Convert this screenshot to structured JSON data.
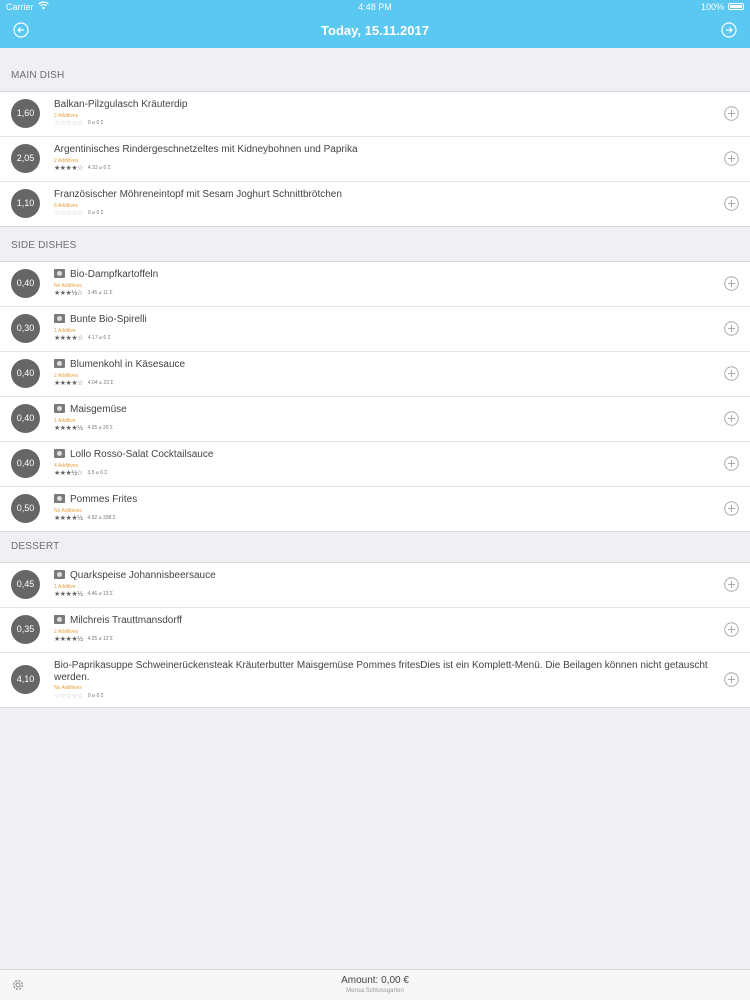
{
  "status_bar": {
    "carrier": "Carrier",
    "time": "4:48 PM",
    "battery": "100%"
  },
  "nav": {
    "title": "Today, 15.11.2017"
  },
  "sections": [
    {
      "header": "MAIN DISH",
      "items": [
        {
          "price": "1,60",
          "name": "Balkan-Pilzgulasch Kräuterdip",
          "has_photo": false,
          "additives": "2 Additives",
          "stars": "☆☆☆☆☆",
          "stars_filled": false,
          "rating_text": "0 ⌀ 0 Σ"
        },
        {
          "price": "2,05",
          "name": "Argentinisches Rindergeschnetzeltes mit Kidneybohnen und Paprika",
          "has_photo": false,
          "additives": "2 Additives",
          "stars": "★★★★☆",
          "stars_filled": true,
          "rating_text": "4.33 ⌀ 6 Σ"
        },
        {
          "price": "1,10",
          "name": "Französischer Möhreneintopf mit Sesam Joghurt Schnittbrötchen",
          "has_photo": false,
          "additives": "8 Additives",
          "stars": "☆☆☆☆☆",
          "stars_filled": false,
          "rating_text": "0 ⌀ 0 Σ"
        }
      ]
    },
    {
      "header": "SIDE DISHES",
      "items": [
        {
          "price": "0,40",
          "name": "Bio-Dampfkartoffeln",
          "has_photo": true,
          "additives": "No Additives",
          "stars": "★★★½☆",
          "stars_filled": true,
          "rating_text": "3.45 ⌀ 11 Σ"
        },
        {
          "price": "0,30",
          "name": "Bunte Bio-Spirelli",
          "has_photo": true,
          "additives": "1 Additive",
          "stars": "★★★★☆",
          "stars_filled": true,
          "rating_text": "4.17 ⌀ 6 Σ"
        },
        {
          "price": "0,40",
          "name": "Blumenkohl in Käsesauce",
          "has_photo": true,
          "additives": "2 Additives",
          "stars": "★★★★☆",
          "stars_filled": true,
          "rating_text": "4.04 ⌀ 23 Σ"
        },
        {
          "price": "0,40",
          "name": "Maisgemüse",
          "has_photo": true,
          "additives": "1 Additive",
          "stars": "★★★★½",
          "stars_filled": true,
          "rating_text": "4.25 ⌀ 20 Σ"
        },
        {
          "price": "0,40",
          "name": "Lollo Rosso-Salat Cocktailsauce",
          "has_photo": true,
          "additives": "4 Additives",
          "stars": "★★★½☆",
          "stars_filled": true,
          "rating_text": "3.5 ⌀ 6 Σ"
        },
        {
          "price": "0,50",
          "name": "Pommes Frites",
          "has_photo": true,
          "additives": "No Additives",
          "stars": "★★★★½",
          "stars_filled": true,
          "rating_text": "4.52 ⌀ 338 Σ"
        }
      ]
    },
    {
      "header": "DESSERT",
      "items": [
        {
          "price": "0,45",
          "name": "Quarkspeise Johannisbeersauce",
          "has_photo": true,
          "additives": "1 Additive",
          "stars": "★★★★½",
          "stars_filled": true,
          "rating_text": "4.46 ⌀ 13 Σ"
        },
        {
          "price": "0,35",
          "name": "Milchreis Trauttmansdorff",
          "has_photo": true,
          "additives": "2 Additives",
          "stars": "★★★★½",
          "stars_filled": true,
          "rating_text": "4.25 ⌀ 12 Σ"
        },
        {
          "price": "4,10",
          "name": "Bio-Paprikasuppe Schweinerückensteak Kräuterbutter Maisgemüse Pommes fritesDies ist ein Komplett-Menü. Die Beilagen können nicht getauscht werden.",
          "has_photo": false,
          "tall": true,
          "additives": "No Additives",
          "stars": "☆☆☆☆☆",
          "stars_filled": false,
          "rating_text": "0 ⌀ 0 Σ"
        }
      ]
    }
  ],
  "footer": {
    "amount": "Amount: 0,00 €",
    "location": "Mensa Schlossgarten"
  },
  "colors": {
    "accent": "#5ac8f0",
    "price_badge": "#666666",
    "additives": "#e8a040",
    "background": "#efeff4"
  }
}
